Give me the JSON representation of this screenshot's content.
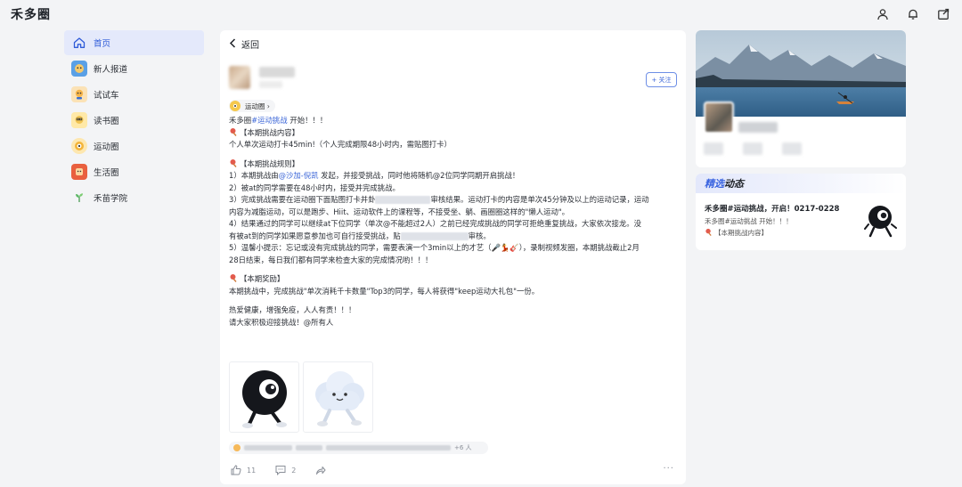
{
  "app": {
    "title": "禾多圈"
  },
  "top_icons": [
    "user-icon",
    "bell-icon",
    "share-icon"
  ],
  "sidebar": {
    "items": [
      {
        "label": "首页",
        "icon": "home-icon",
        "active": true
      },
      {
        "label": "新人报道",
        "icon": "newcomer-icon"
      },
      {
        "label": "试试车",
        "icon": "test-drive-icon"
      },
      {
        "label": "读书圈",
        "icon": "reading-icon"
      },
      {
        "label": "运动圈",
        "icon": "sports-icon"
      },
      {
        "label": "生活圈",
        "icon": "life-icon"
      },
      {
        "label": "禾苗学院",
        "icon": "academy-icon"
      }
    ]
  },
  "post": {
    "back_label": "返回",
    "follow_label": "+ 关注",
    "circle_tag": "运动圈 ›",
    "intro_prefix": "禾多圈",
    "intro_hashtag": "#运动挑战",
    "intro_suffix": " 开始！！！",
    "section1_title": "【本期挑战内容】",
    "section1_body": "个人单次运动打卡45min!（个人完成期限48小时内，需贴图打卡）",
    "section2_title": "【本期挑战规则】",
    "rule1_a": "1）本期挑战由",
    "rule1_mention": "@沙加-倪凯",
    "rule1_b": " 发起，并接受挑战，同时他将随机@2位同学同期开启挑战！",
    "rule2": "2）被at的同学需要在48小时内，接受并完成挑战。",
    "rule3_a": "3）完成挑战需要在运动圈下面贴图打卡并卦",
    "rule3_b": "审核结果。运动打卡的内容是单次45分钟及以上的运动记录，运动",
    "rule3_c": "内容为减脂运动，可以是跑步、Hiit、运动软件上的课程等，不接受坐、躺、画圈圈这样的\"懒人运动\"。",
    "rule4_a": "4）结果通过的同学可以继续at下位同学（单次@不能超过2人）之前已经完成挑战的同学可拒绝重复挑战，大家依次接龙。没",
    "rule4_b": "有被at到的同学如果愿意参加也可自行接受挑战，贴",
    "rule4_c": "审核。",
    "rule5_a": "5）温馨小提示：忘记或没有完成挑战的同学，需要表演一个3min以上的才艺（🎤💃🎸），录制视频发圈，本期挑战截止2月",
    "rule5_b": "28日结束，每日我们都有同学来检查大家的完成情况哟！！！",
    "section3_title": "【本期奖励】",
    "section3_body": "本期挑战中，完成挑战\"单次消耗千卡数量\"Top3的同学，每人将获得\"keep运动大礼包\"一份。",
    "closing1": "热爱健康，增强免疫，人人有责！！！",
    "closing2": "请大家积极迎接挑战！@所有人",
    "reactions_more": "+6 人",
    "like_count": "11",
    "comment_count": "2"
  },
  "featured": {
    "heading_accent": "精选",
    "heading_rest": "动态",
    "title": "禾多圈#运动挑战，开启！0217-0228",
    "line1": "禾多圈#运动挑战 开始！！！",
    "line2": "【本期挑战内容】"
  },
  "colors": {
    "accent": "#3b66d8",
    "active_bg": "#e4e9fb",
    "page_bg": "#f3f4f6"
  }
}
